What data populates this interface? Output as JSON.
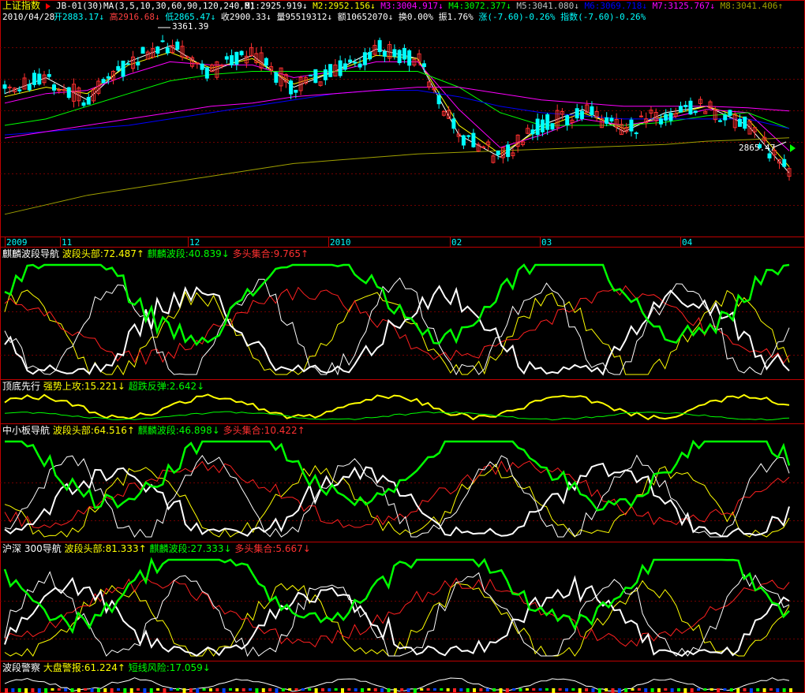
{
  "header": {
    "index_name": "上证指数",
    "period": "JB-01(30)",
    "ma_params": "MA(3,5,10,30,60,90,120,240,8)",
    "ma_items": [
      {
        "label": "M1:2925.919↓",
        "color": "#ffffff"
      },
      {
        "label": "M2:2952.156↓",
        "color": "#ffff00"
      },
      {
        "label": "M3:3004.917↓",
        "color": "#ff00ff"
      },
      {
        "label": "M4:3072.377↓",
        "color": "#00ff00"
      },
      {
        "label": "M5:3041.080↓",
        "color": "#c0c0c0"
      },
      {
        "label": "M6:3069.718↓",
        "color": "#0000ff"
      },
      {
        "label": "M7:3125.767↓",
        "color": "#ff00ff"
      },
      {
        "label": "M8:3041.406↑",
        "color": "#a0a000"
      }
    ],
    "date": "2010/04/28",
    "quote_items": [
      {
        "label": "开2883.17↓",
        "color": "#00ffff"
      },
      {
        "label": "高2916.68↓",
        "color": "#ff4040"
      },
      {
        "label": "低2865.47↓",
        "color": "#00ffff"
      },
      {
        "label": "收2900.33↓",
        "color": "#ffffff"
      },
      {
        "label": "量95519312↓",
        "color": "#ffffff"
      },
      {
        "label": "额10652070↓",
        "color": "#ffffff"
      },
      {
        "label": "换0.00%",
        "color": "#ffffff"
      },
      {
        "label": "振1.76%",
        "color": "#ffffff"
      },
      {
        "label": "涨(-7.60)-0.26%",
        "color": "#00ffff"
      },
      {
        "label": "指数(-7.60)-0.26%",
        "color": "#00ffff"
      }
    ],
    "high_label": "3361.39",
    "low_label": "2865.47"
  },
  "time_axis": [
    "2009",
    "11",
    "12",
    "2010",
    "02",
    "03",
    "04"
  ],
  "panels": [
    {
      "title": "麒麟波段导航",
      "items": [
        {
          "label": "波段头部:72.487↑",
          "color": "#ffff00"
        },
        {
          "label": "麒麟波段:40.839↓",
          "color": "#00ff00"
        },
        {
          "label": "多头集合:9.765↑",
          "color": "#ff3030"
        }
      ]
    },
    {
      "title": "顶底先行",
      "items": [
        {
          "label": "强势上攻:15.221↓",
          "color": "#ffff00"
        },
        {
          "label": "超跌反弹:2.642↓",
          "color": "#00ff00"
        }
      ]
    },
    {
      "title": "中小板导航",
      "items": [
        {
          "label": "波段头部:64.516↑",
          "color": "#ffff00"
        },
        {
          "label": "麒麟波段:46.898↓",
          "color": "#00ff00"
        },
        {
          "label": "多头集合:10.422↑",
          "color": "#ff3030"
        }
      ]
    },
    {
      "title": "沪深 300导航",
      "items": [
        {
          "label": "波段头部:81.333↑",
          "color": "#ffff00"
        },
        {
          "label": "麒麟波段:27.333↓",
          "color": "#00ff00"
        },
        {
          "label": "多头集合:5.667↓",
          "color": "#ff3030"
        }
      ]
    },
    {
      "title": "波段警察",
      "items": [
        {
          "label": "大盘警报:61.224↑",
          "color": "#ffff00"
        },
        {
          "label": "短线风险:17.059↓",
          "color": "#00ff00"
        }
      ]
    }
  ],
  "chart_data": {
    "type": "line",
    "title": "上证指数",
    "x": [
      "2009",
      "11",
      "12",
      "2010",
      "02",
      "03",
      "04"
    ],
    "series": [
      {
        "name": "M1",
        "color": "#ffffff",
        "values": [
          3180,
          3230,
          3160,
          3280,
          3330,
          3250,
          3300,
          3200,
          3250,
          3320,
          3290,
          3050,
          2980,
          3080,
          3130,
          3060,
          3120,
          3140,
          3080,
          2930
        ]
      },
      {
        "name": "M2",
        "color": "#ffff00",
        "values": [
          3170,
          3200,
          3180,
          3270,
          3310,
          3260,
          3290,
          3210,
          3250,
          3300,
          3290,
          3080,
          2990,
          3070,
          3120,
          3070,
          3110,
          3140,
          3100,
          2950
        ]
      },
      {
        "name": "M3",
        "color": "#ff00ff",
        "values": [
          3150,
          3180,
          3190,
          3240,
          3280,
          3270,
          3270,
          3230,
          3250,
          3280,
          3280,
          3130,
          3010,
          3050,
          3100,
          3080,
          3100,
          3130,
          3120,
          3000
        ]
      },
      {
        "name": "M4",
        "color": "#00ff00",
        "values": [
          3080,
          3100,
          3140,
          3180,
          3220,
          3240,
          3250,
          3250,
          3250,
          3250,
          3250,
          3200,
          3120,
          3080,
          3080,
          3080,
          3090,
          3110,
          3120,
          3070
        ]
      },
      {
        "name": "M6",
        "color": "#0000ff",
        "values": [
          3050,
          3060,
          3070,
          3080,
          3100,
          3120,
          3140,
          3160,
          3180,
          3190,
          3190,
          3170,
          3140,
          3120,
          3110,
          3100,
          3100,
          3100,
          3100,
          3070
        ]
      },
      {
        "name": "M7",
        "color": "#ff00ff",
        "values": [
          3040,
          3060,
          3080,
          3100,
          3120,
          3140,
          3150,
          3170,
          3180,
          3190,
          3200,
          3200,
          3180,
          3160,
          3150,
          3140,
          3140,
          3140,
          3135,
          3125
        ]
      },
      {
        "name": "M8",
        "color": "#a0a000",
        "values": [
          2800,
          2830,
          2860,
          2880,
          2900,
          2920,
          2940,
          2960,
          2970,
          2980,
          2990,
          2995,
          3000,
          3005,
          3010,
          3015,
          3020,
          3030,
          3035,
          3041
        ]
      }
    ],
    "annotations": [
      "3361.39",
      "2865.47"
    ]
  }
}
